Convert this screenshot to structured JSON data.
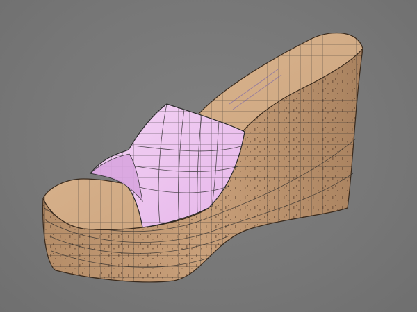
{
  "scene": {
    "subject": "wireframe-shoe-render",
    "colors": {
      "background": "#7a7a7a",
      "cork": "#c9a07a",
      "cork_dark": "#8a6a4a",
      "footbed": "#d6b290",
      "strap": "#f0c8f0",
      "strap_shadow": "#cfa0d8",
      "wire": "#2a2a2a"
    }
  }
}
